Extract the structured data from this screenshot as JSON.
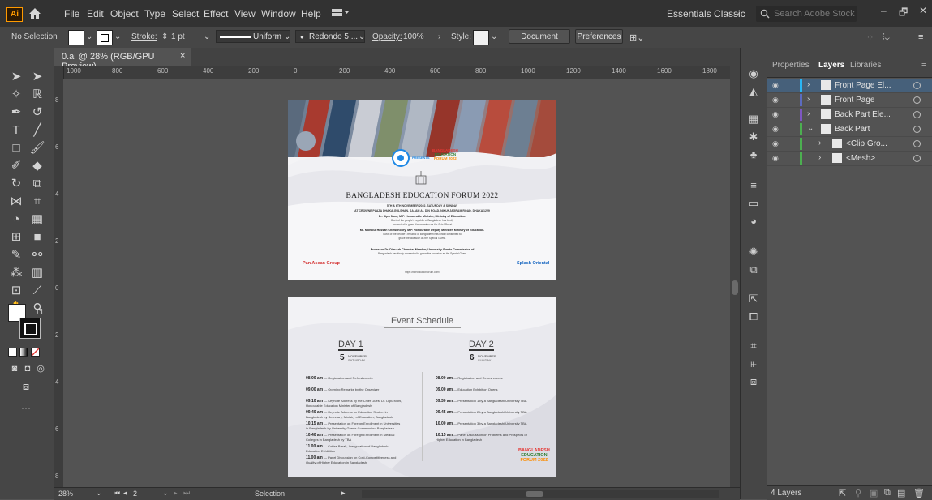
{
  "app": {
    "logo": "Ai",
    "workspace": "Essentials Classic",
    "search_placeholder": "Search Adobe Stock"
  },
  "menu": [
    "File",
    "Edit",
    "Object",
    "Type",
    "Select",
    "Effect",
    "View",
    "Window",
    "Help"
  ],
  "window_controls": {
    "minimize": "–",
    "restore": "🗗",
    "close": "✕"
  },
  "control_bar": {
    "selection": "No Selection",
    "stroke_label": "Stroke:",
    "stroke_value": "1 pt",
    "profile": "Uniform",
    "brush": "Redondo 5 ...",
    "opacity_label": "Opacity:",
    "opacity_value": "100%",
    "style_label": "Style:",
    "document_setup": "Document Setup",
    "preferences": "Preferences"
  },
  "document": {
    "tab_title": "0.ai @ 28% (RGB/GPU Preview)",
    "close": "×",
    "zoom": "28%",
    "page": "2",
    "status": "Selection"
  },
  "ruler": {
    "h_ticks": [
      "1000",
      "800",
      "600",
      "400",
      "200",
      "0",
      "200",
      "400",
      "600",
      "800",
      "1000",
      "1200",
      "1400",
      "1600",
      "1800"
    ],
    "v_ticks": [
      "8",
      "6",
      "4",
      "2",
      "0",
      "2",
      "4",
      "6",
      "8"
    ]
  },
  "panels": {
    "tabs": [
      "Properties",
      "Layers",
      "Libraries"
    ],
    "active_tab": "Layers",
    "footer_count": "4 Layers"
  },
  "layers": [
    {
      "name": "Front Page El...",
      "bar_color": "#29b6f6",
      "indent": 0,
      "expanded": false,
      "selected": true
    },
    {
      "name": "Front Page",
      "bar_color": "#5c6bc0",
      "indent": 0,
      "expanded": false,
      "selected": false
    },
    {
      "name": "Back Part Ele...",
      "bar_color": "#7e57c2",
      "indent": 0,
      "expanded": false,
      "selected": false
    },
    {
      "name": "Back Part",
      "bar_color": "#4caf50",
      "indent": 0,
      "expanded": true,
      "selected": false
    },
    {
      "name": "<Clip Gro...",
      "bar_color": "#4caf50",
      "indent": 1,
      "expanded": false,
      "selected": false
    },
    {
      "name": "<Mesh>",
      "bar_color": "#4caf50",
      "indent": 1,
      "expanded": false,
      "selected": false
    }
  ],
  "artboard_front": {
    "presents": "PRESENTS",
    "logo_text": [
      "BANGLADESH",
      "EDUCATION",
      "FORUM 2022"
    ],
    "title": "BANGLADESH EDUCATION FORUM 2022",
    "date_line": "5TH & 6TH NOVEMBER 2022, SATURDAY & SUNDAY",
    "venue_line": "AT CROWNE PLAZA DHAKA-GULSHAN, SALAM AL DIN ROAD, NIKUNJAGRAM ROAD, DHAKA 1229",
    "guest1": "Dr. Dipu Moni, M.P. Honourable Minister, Ministry of Education.",
    "guest1_sub1": "Govt. of the people's republic of Bangladesh has kindly",
    "guest1_sub2": "consented to grace the occasion as the Chief Guest",
    "guest2": "Mr. Mohibul Hassan Chowdhoury, M.P. Honourable Deputy Minister, Ministry of Education.",
    "guest2_sub1": "Govt. of the people's republic of Bangladesh has kindly consented to",
    "guest2_sub2": "grace the occasion as the Special Guest.",
    "guest3": "Professor Dr. Dilruzzh Chandra, Member, University Grants Commission of",
    "guest3_sub": "Bangladesh has kindly consented to grace the occasion as the Special Guest",
    "sponsor_left": "Pan Asean Group",
    "sponsor_right": "Splash Oriental",
    "url": "https://bdeducationforum.com/"
  },
  "artboard_schedule": {
    "title": "Event Schedule",
    "day1": {
      "label": "DAY 1",
      "date": "5",
      "month": "NOVEMBER",
      "weekday": "SATURDAY"
    },
    "day2": {
      "label": "DAY 2",
      "date": "6",
      "month": "NOVEMBER",
      "weekday": "SUNDAY"
    },
    "day1_items": [
      {
        "time": "08.00 am",
        "text": "Registration and Refreshments"
      },
      {
        "time": "09.00 am",
        "text": "Opening Remarks by the Organizer"
      },
      {
        "time": "09.10 am",
        "text": "Keynote Address by the Chief Guest Dr. Dipu Moni, Honourable Education Minister of Bangladesh"
      },
      {
        "time": "09.40 am",
        "text": "Keynote Address on Education System in Bangladesh by Secretary, Ministry of Education, Bangladesh"
      },
      {
        "time": "10.15 am",
        "text": "Presentation on Foreign Enrollment in Universities in Bangladesh by University Grants Commission, Bangladesh"
      },
      {
        "time": "10.40 am",
        "text": "Presentation on Foreign Enrollment in Medical Colleges in Bangladesh by TBA"
      },
      {
        "time": "11.00 am",
        "text": "Coffee Break, Inauguration of Bangladesh Education Exhibition"
      },
      {
        "time": "11.00 am",
        "text": "Panel Discussion on Cost-Competitiveness and Quality of Higher Education in Bangladesh"
      }
    ],
    "day2_items": [
      {
        "time": "08.00 am",
        "text": "Registration and Refreshments"
      },
      {
        "time": "09.00 am",
        "text": "Education Exhibition Opens"
      },
      {
        "time": "09.30 am",
        "text": "Presentation 1 by a Bangladeshi University TBA"
      },
      {
        "time": "09.45 am",
        "text": "Presentation 2 by a Bangladeshi University TBA"
      },
      {
        "time": "10.00 am",
        "text": "Presentation 3 by a Bangladeshi University TBA"
      },
      {
        "time": "10.15 am",
        "text": "Panel Discussion on Problems and Prospects of Higher Education in Bangladesh"
      }
    ],
    "logo_text": [
      "BANGLADESH",
      "EDUCATION",
      "FORUM 2022"
    ]
  },
  "colors": {
    "accent": "#ff9a00",
    "panel_bg": "#535353",
    "selected_layer": "#46607a",
    "logo_red": "#e53935",
    "logo_green": "#2e7d32",
    "logo_orange": "#fb8c00"
  }
}
